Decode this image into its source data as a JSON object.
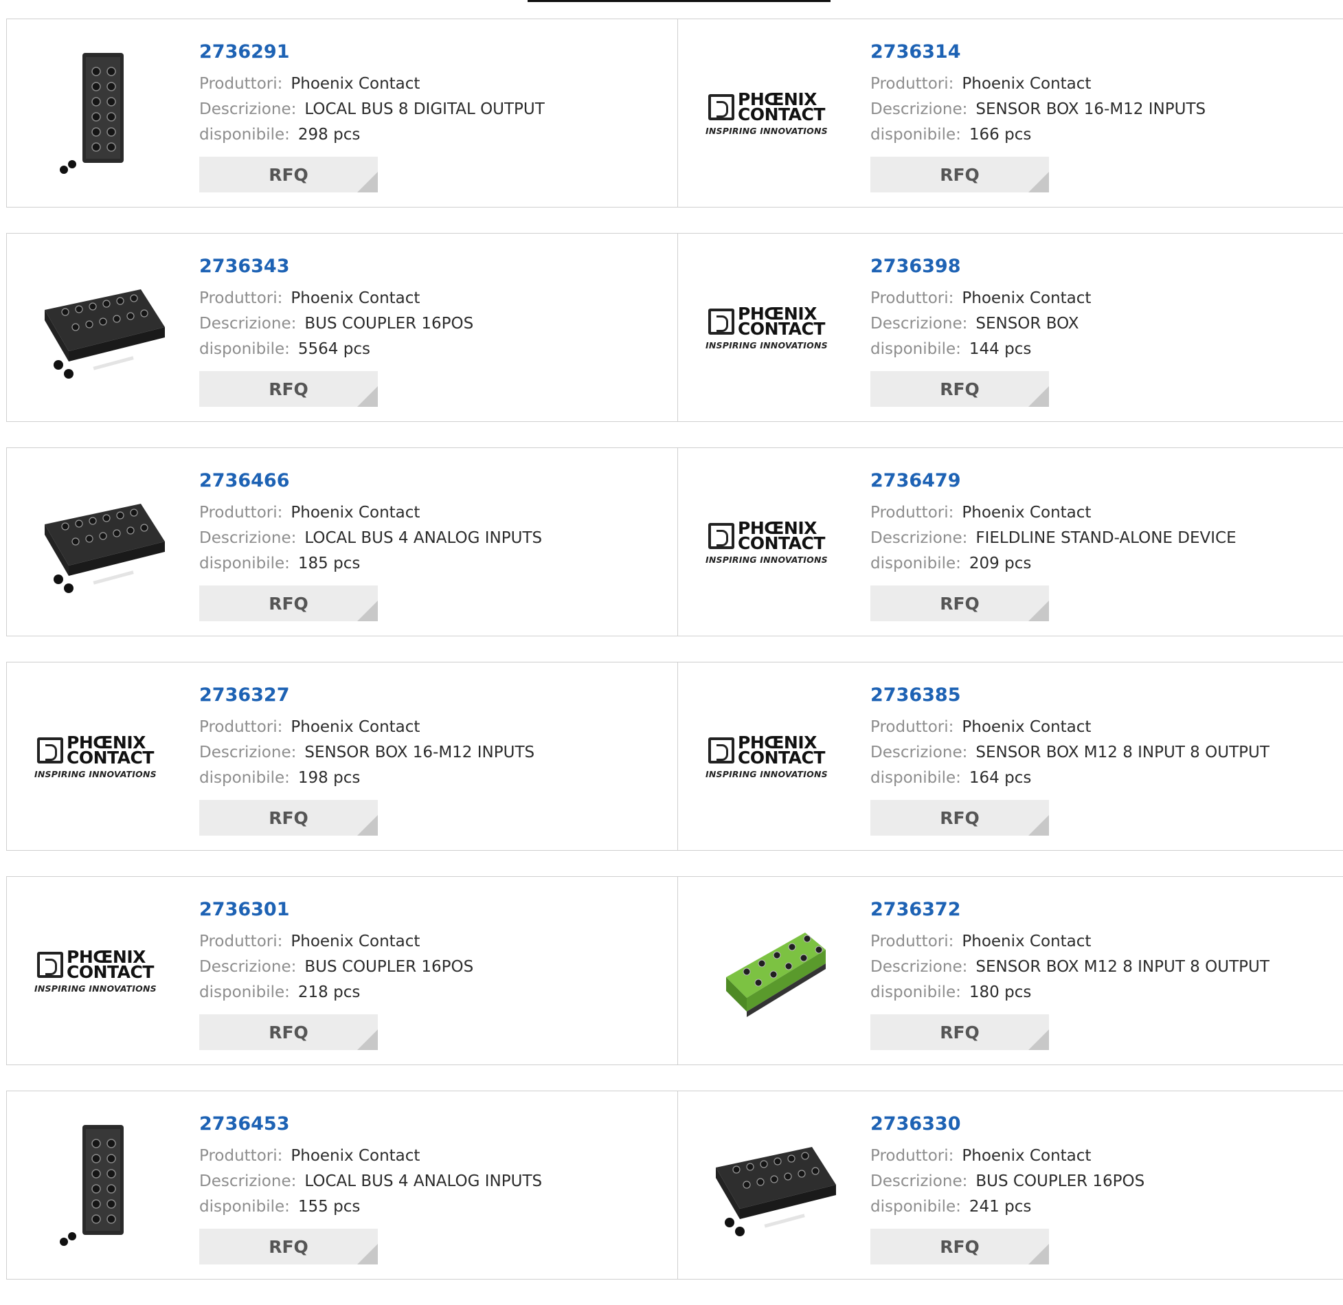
{
  "logo": {
    "line1": "PHŒNIX",
    "line2": "CONTACT",
    "tagline": "INSPIRING INNOVATIONS"
  },
  "labels": {
    "manufacturer": "Produttori:",
    "description": "Descrizione:",
    "available": "disponibile:",
    "rfq": "RFQ"
  },
  "products": [
    {
      "pn": "2736291",
      "mfr": "Phoenix Contact",
      "desc": "LOCAL BUS 8 DIGITAL OUTPUT",
      "stock": "298 pcs",
      "image": "tall-black-module"
    },
    {
      "pn": "2736314",
      "mfr": "Phoenix Contact",
      "desc": "SENSOR BOX 16-M12 INPUTS",
      "stock": "166 pcs",
      "image": "logo"
    },
    {
      "pn": "2736343",
      "mfr": "Phoenix Contact",
      "desc": "BUS COUPLER 16POS",
      "stock": "5564 pcs",
      "image": "flat-black-module"
    },
    {
      "pn": "2736398",
      "mfr": "Phoenix Contact",
      "desc": "SENSOR BOX",
      "stock": "144 pcs",
      "image": "logo"
    },
    {
      "pn": "2736466",
      "mfr": "Phoenix Contact",
      "desc": "LOCAL BUS 4 ANALOG INPUTS",
      "stock": "185 pcs",
      "image": "flat-black-module"
    },
    {
      "pn": "2736479",
      "mfr": "Phoenix Contact",
      "desc": "FIELDLINE STAND-ALONE DEVICE",
      "stock": "209 pcs",
      "image": "logo"
    },
    {
      "pn": "2736327",
      "mfr": "Phoenix Contact",
      "desc": "SENSOR BOX 16-M12 INPUTS",
      "stock": "198 pcs",
      "image": "logo"
    },
    {
      "pn": "2736385",
      "mfr": "Phoenix Contact",
      "desc": "SENSOR BOX M12 8 INPUT 8 OUTPUT",
      "stock": "164 pcs",
      "image": "logo"
    },
    {
      "pn": "2736301",
      "mfr": "Phoenix Contact",
      "desc": "BUS COUPLER 16POS",
      "stock": "218 pcs",
      "image": "logo"
    },
    {
      "pn": "2736372",
      "mfr": "Phoenix Contact",
      "desc": "SENSOR BOX M12 8 INPUT 8 OUTPUT",
      "stock": "180 pcs",
      "image": "green-module"
    },
    {
      "pn": "2736453",
      "mfr": "Phoenix Contact",
      "desc": "LOCAL BUS 4 ANALOG INPUTS",
      "stock": "155 pcs",
      "image": "tall-black-module"
    },
    {
      "pn": "2736330",
      "mfr": "Phoenix Contact",
      "desc": "BUS COUPLER 16POS",
      "stock": "241 pcs",
      "image": "flat-black-module"
    }
  ],
  "colors": {
    "link": "#1d62b4",
    "label": "#8d8d8d",
    "value": "#2b2b2b",
    "button_bg": "#ececec",
    "border": "#cfcfcf"
  }
}
